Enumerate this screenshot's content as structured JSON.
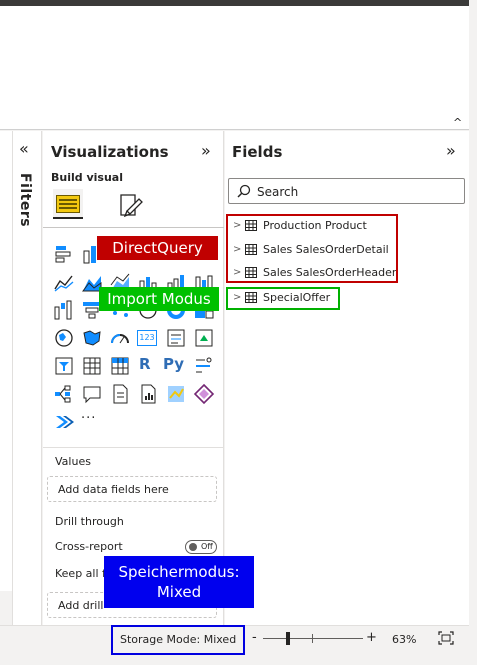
{
  "filters": {
    "label": "Filters"
  },
  "visualizations": {
    "title": "Visualizations",
    "subtitle": "Build visual",
    "values_label": "Values",
    "values_placeholder": "Add data fields here",
    "drill_through_label": "Drill through",
    "cross_report_label": "Cross-report",
    "cross_report_toggle": "Off",
    "keep_all_filters_label": "Keep all f",
    "drill_placeholder": "Add drill-"
  },
  "fields": {
    "title": "Fields",
    "search_placeholder": "Search",
    "tables": [
      {
        "name": "Production Product"
      },
      {
        "name": "Sales SalesOrderDetail"
      },
      {
        "name": "Sales SalesOrderHeader"
      },
      {
        "name": "SpecialOffer"
      }
    ]
  },
  "annotations": {
    "directquery": "DirectQuery",
    "import": "Import Modus",
    "storage_line1": "Speichermodus:",
    "storage_line2": "Mixed"
  },
  "statusbar": {
    "storage_mode": "Storage Mode: Mixed",
    "zoom_minus": "-",
    "zoom_plus": "+",
    "zoom_percent": "63%",
    "zoom_level": 0.25
  },
  "visual_icons": {
    "r_label": "R",
    "py_label": "Py",
    "kpi_label": "123",
    "more_label": "···"
  },
  "colors": {
    "directquery": "#c00000",
    "import": "#00c000",
    "storage": "#0000ee",
    "accent": "#f2c80f",
    "viz_blue": "#118dff"
  }
}
